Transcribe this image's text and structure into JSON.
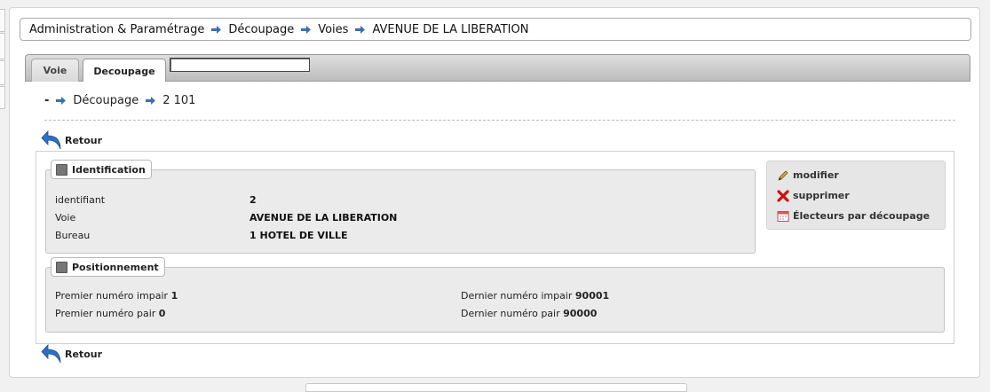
{
  "breadcrumb": {
    "items": [
      "Administration & Paramétrage",
      "Découpage",
      "Voies",
      "AVENUE DE LA LIBERATION"
    ]
  },
  "tabs": [
    {
      "label": "Voie",
      "active": false
    },
    {
      "label": "Decoupage",
      "active": true
    }
  ],
  "tab_search": {
    "value": ""
  },
  "sub_breadcrumb": {
    "prefix": "-",
    "section": "Découpage",
    "current": "2 101"
  },
  "retour_label": "Retour",
  "identification": {
    "title": "Identification",
    "rows": [
      {
        "label": "identifiant",
        "value": "2"
      },
      {
        "label": "Voie",
        "value": "AVENUE DE LA LIBERATION"
      },
      {
        "label": "Bureau",
        "value": "1 HOTEL DE VILLE"
      }
    ]
  },
  "positionnement": {
    "title": "Positionnement",
    "premier_impair_label": "Premier numéro impair",
    "premier_impair_value": "1",
    "premier_pair_label": "Premier numéro pair",
    "premier_pair_value": "0",
    "dernier_impair_label": "Dernier numéro impair",
    "dernier_impair_value": "90001",
    "dernier_pair_label": "Dernier numéro pair",
    "dernier_pair_value": "90000"
  },
  "actions": {
    "modifier": "modifier",
    "supprimer": "supprimer",
    "electeurs": "Électeurs par découpage"
  },
  "colors": {
    "arrow": "#3b6fb6",
    "delete": "#cc1111",
    "pencil": "#c79a2e"
  }
}
